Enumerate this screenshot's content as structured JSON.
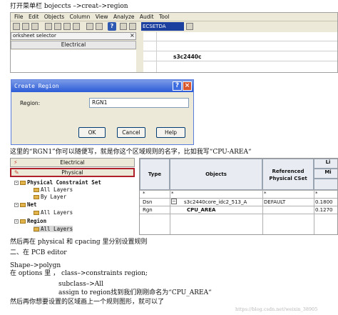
{
  "line1": "打开菜单栏 bojeccts –>creat–>region",
  "menu_items": [
    "File",
    "Edit",
    "Objects",
    "Column",
    "View",
    "Analyze",
    "Audit",
    "Tool"
  ],
  "toolbar_dropdown": "ECSETDA",
  "worksheet_selector": "orksheet selector",
  "worksheet_close": "×",
  "worksheet_electrical": "Electrical",
  "design_name_top": "s3c2440c",
  "dialog": {
    "title": "Create Region",
    "region_label": "Region:",
    "region_value": "RGN1",
    "ok_label": "OK",
    "cancel_label": "Cancel",
    "help_label": "Help"
  },
  "caption2": "这里的“RGN1”你可以随便写，就是你这个区域规则的名字，比如我写“CPU-AREA“",
  "tree": {
    "electrical": "Electrical",
    "physical": "Physical",
    "items": [
      {
        "label": "Physical Constraint Set",
        "bold": true
      },
      {
        "label": "All Layers",
        "bold": false
      },
      {
        "label": "By Layer",
        "bold": false
      },
      {
        "label": "Net",
        "bold": true
      },
      {
        "label": "All Layers",
        "bold": false
      },
      {
        "label": "Region",
        "bold": true
      },
      {
        "label": "All Layers",
        "bold": false
      }
    ]
  },
  "sheet": {
    "col_type": "Type",
    "col_objects": "Objects",
    "col_ref": "Referenced Physical CSet",
    "col_line": "Li",
    "col_min": "Mi",
    "star": "*",
    "rows": [
      {
        "type": "Dsn",
        "objects": "s3c2440core_idc2_513_A",
        "ref": "DEFAULT",
        "val": "0.1800"
      },
      {
        "type": "Rgn",
        "objects": "CPU_AREA",
        "ref": "",
        "val": "0.1270"
      }
    ]
  },
  "line3": "然后再在 physical 和 cpacing  里分别设置规则",
  "line4": "二、在 PCB  editor",
  "line5": "Shape–>polygn",
  "line6": "在 options  里 ， class–>constraints  region;",
  "line7": "subclass–>All",
  "line8": "assign  to  region找到我们刚刚命名为“CPU_AREA“",
  "line9": "然后再你想要设置的区域画上一个规则图形，就可以了",
  "watermark": "https://blog.csdn.net/weixin_38905"
}
